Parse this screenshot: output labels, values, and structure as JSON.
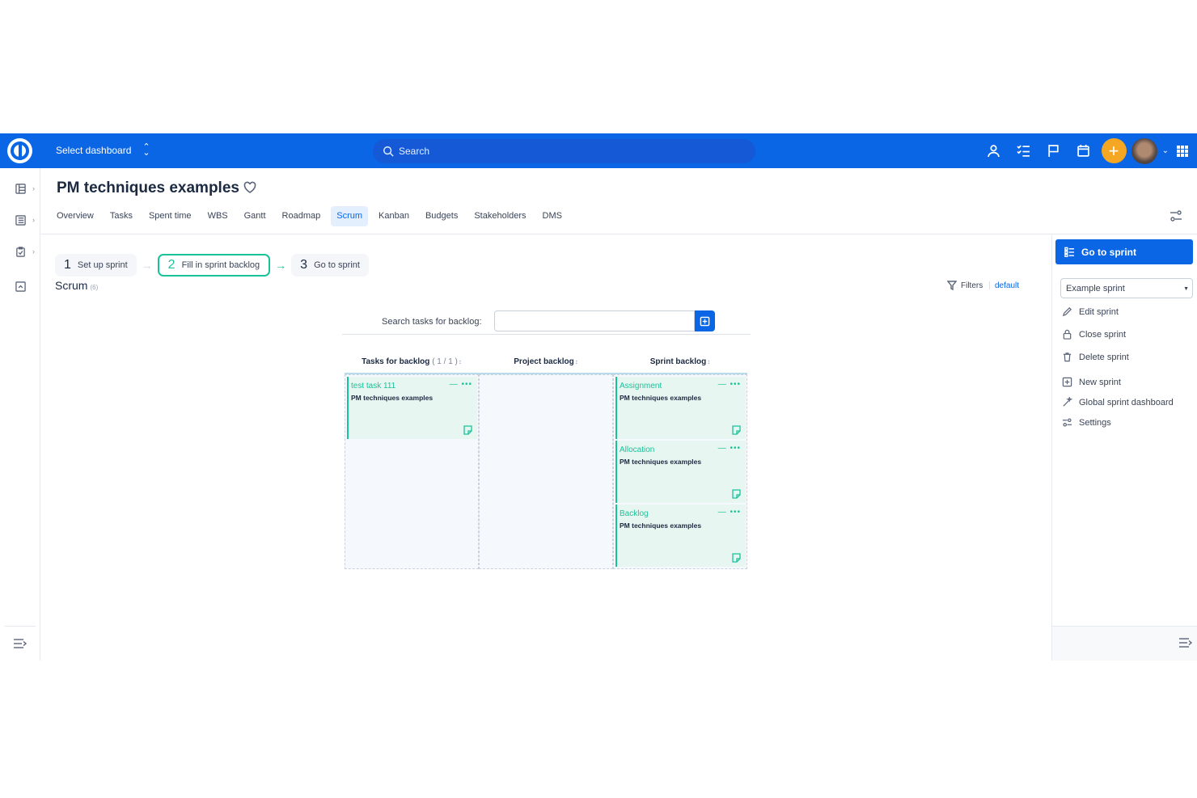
{
  "topbar": {
    "dashboard_label": "Select dashboard",
    "search_placeholder": "Search",
    "icons": [
      "user-icon",
      "task-list-icon",
      "flag-icon",
      "calendar-icon",
      "plus-icon",
      "avatar",
      "chevron-down-icon",
      "apps-grid-icon"
    ],
    "brand_color": "#0a66e4",
    "accent_color": "#f5a623"
  },
  "leftrail": {
    "items": [
      "dashboard-icon",
      "list-icon",
      "clipboard-icon",
      "collapse-square-icon"
    ],
    "bottom_icon": "expand-menu-icon"
  },
  "header": {
    "title": "PM techniques examples",
    "tabs": [
      {
        "label": "Overview"
      },
      {
        "label": "Tasks"
      },
      {
        "label": "Spent time"
      },
      {
        "label": "WBS"
      },
      {
        "label": "Gantt"
      },
      {
        "label": "Roadmap"
      },
      {
        "label": "Scrum"
      },
      {
        "label": "Kanban"
      },
      {
        "label": "Budgets"
      },
      {
        "label": "Stakeholders"
      },
      {
        "label": "DMS"
      }
    ],
    "active_tab": "Scrum"
  },
  "steps": [
    {
      "num": "1",
      "label": "Set up sprint"
    },
    {
      "num": "2",
      "label": "Fill in sprint backlog"
    },
    {
      "num": "3",
      "label": "Go to sprint"
    }
  ],
  "scrum": {
    "title": "Scrum",
    "count": "(6)",
    "filters_label": "Filters",
    "default_label": "default",
    "search_label": "Search tasks for backlog:"
  },
  "board": {
    "columns": [
      {
        "label": "Tasks for backlog",
        "sub": "( 1 / 1 )"
      },
      {
        "label": "Project backlog",
        "sub": ""
      },
      {
        "label": "Sprint backlog",
        "sub": ""
      }
    ],
    "tasks_for_backlog": [
      {
        "title": "test task 111",
        "project": "PM techniques examples"
      }
    ],
    "sprint_backlog": [
      {
        "title": "Assignment",
        "project": "PM techniques examples"
      },
      {
        "title": "Allocation",
        "project": "PM techniques examples"
      },
      {
        "title": "Backlog",
        "project": "PM techniques examples"
      }
    ],
    "card_color": "#19c39a"
  },
  "rightbar": {
    "goto_label": "Go to sprint",
    "sprint_value": "Example sprint",
    "menu": [
      {
        "label": "Edit sprint",
        "icon": "pencil-icon"
      },
      {
        "label": "Close sprint",
        "icon": "lock-icon"
      },
      {
        "label": "Delete sprint",
        "icon": "trash-icon"
      },
      {
        "label": "New sprint",
        "icon": "plus-square-icon"
      },
      {
        "label": "Global sprint dashboard",
        "icon": "sparkle-icon"
      },
      {
        "label": "Settings",
        "icon": "settings-sliders-icon"
      }
    ]
  }
}
